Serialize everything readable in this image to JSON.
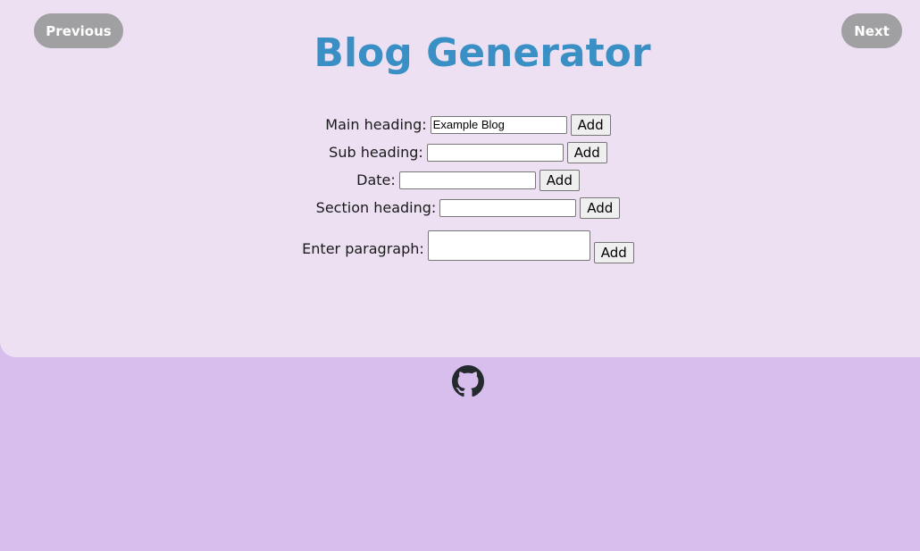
{
  "nav": {
    "previous_label": "Previous",
    "next_label": "Next"
  },
  "page": {
    "title": "Blog Generator"
  },
  "form": {
    "main_heading": {
      "label": "Main heading:",
      "value": "Example Blog",
      "button": "Add"
    },
    "sub_heading": {
      "label": "Sub heading:",
      "value": "",
      "button": "Add"
    },
    "date": {
      "label": "Date:",
      "value": "",
      "button": "Add"
    },
    "section_heading": {
      "label": "Section heading:",
      "value": "",
      "button": "Add"
    },
    "paragraph": {
      "label": "Enter paragraph:",
      "value": "",
      "button": "Add"
    }
  },
  "footer": {
    "icon": "github-icon"
  },
  "colors": {
    "title": "#3a90c4",
    "panel_bg": "#ece0f2",
    "page_bg": "#d8beed",
    "nav_button_bg": "#a09fa1"
  }
}
